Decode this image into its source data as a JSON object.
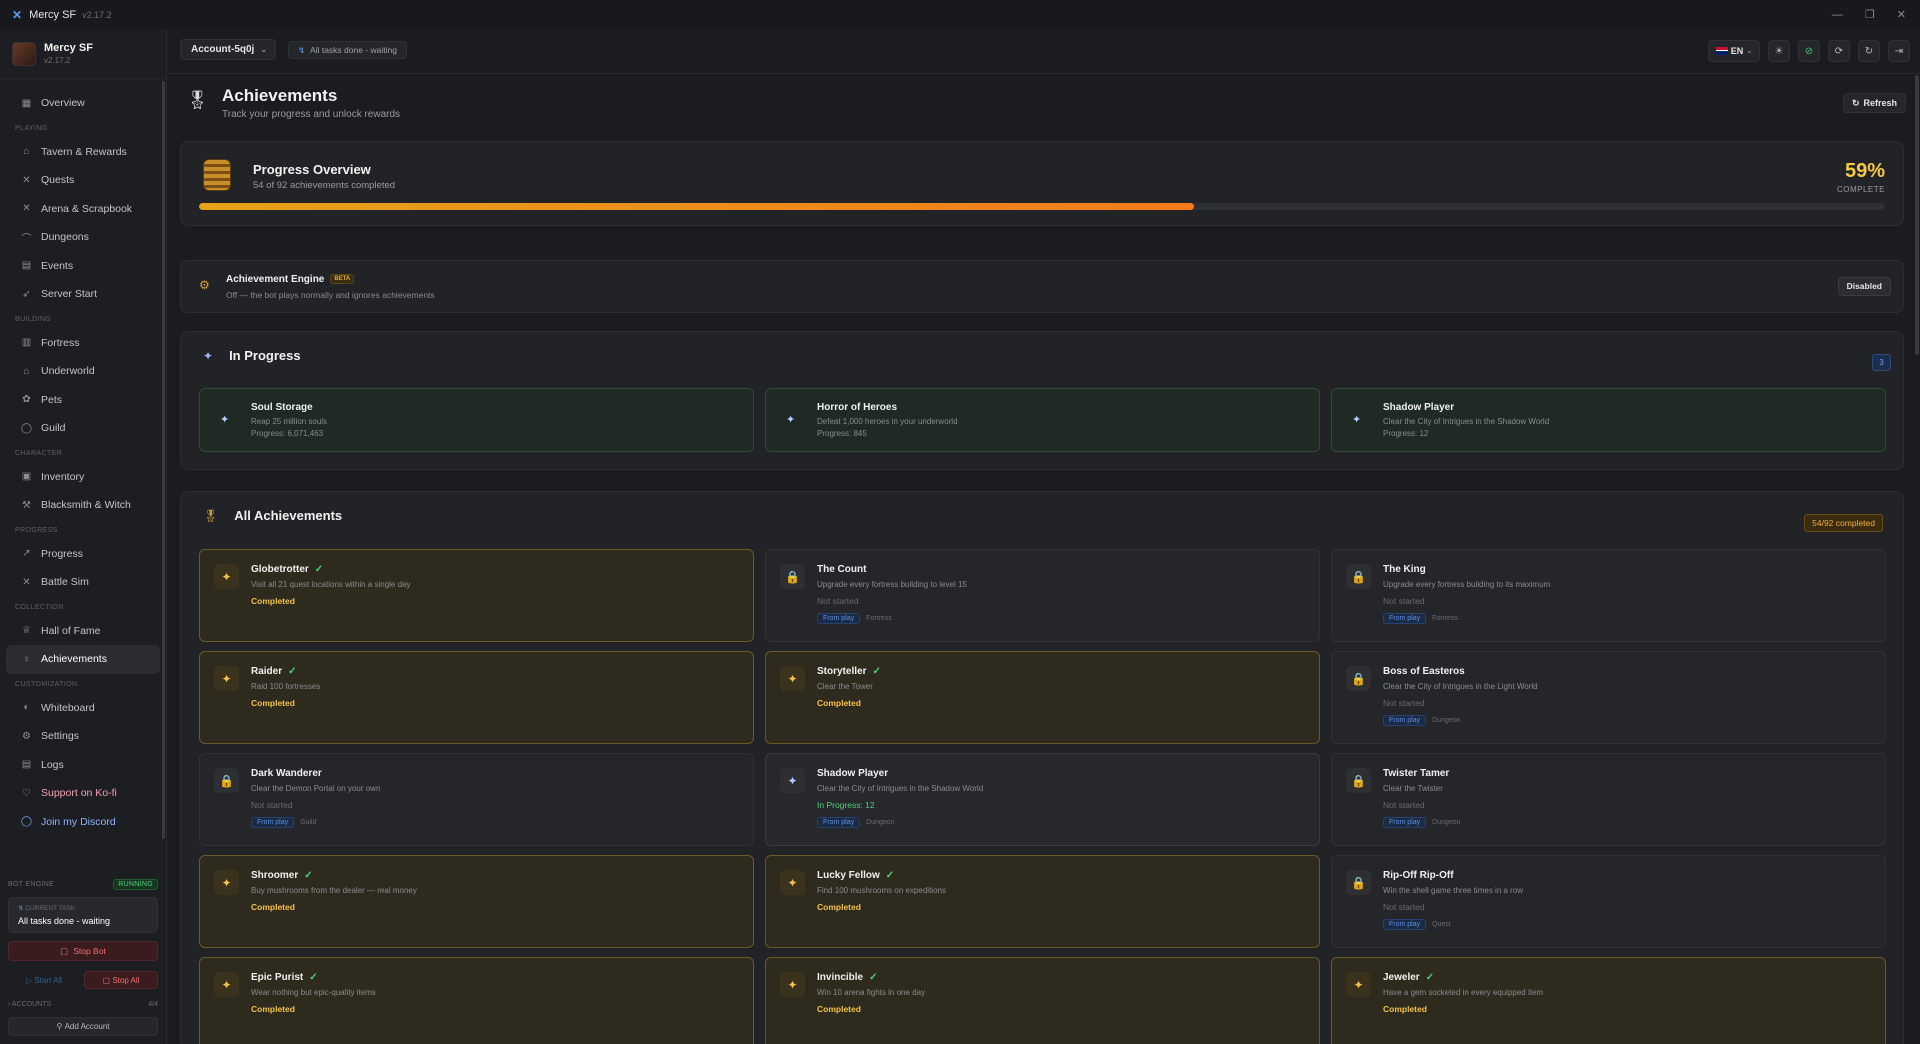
{
  "window": {
    "title": "Mercy SF",
    "version": "v2.17.2"
  },
  "brand": {
    "name": "Mercy SF",
    "version": "v2.17.2"
  },
  "sidebar": [
    {
      "type": "item",
      "label": "Overview",
      "icon": "grid-icon"
    },
    {
      "type": "section",
      "label": "PLAYING"
    },
    {
      "type": "item",
      "label": "Tavern & Rewards",
      "icon": "tavern-icon"
    },
    {
      "type": "item",
      "label": "Quests",
      "icon": "swords-icon"
    },
    {
      "type": "item",
      "label": "Arena & Scrapbook",
      "icon": "arena-icon"
    },
    {
      "type": "item",
      "label": "Dungeons",
      "icon": "dungeon-icon"
    },
    {
      "type": "item",
      "label": "Events",
      "icon": "calendar-icon"
    },
    {
      "type": "item",
      "label": "Server Start",
      "icon": "rocket-icon"
    },
    {
      "type": "section",
      "label": "BUILDING"
    },
    {
      "type": "item",
      "label": "Fortress",
      "icon": "castle-icon"
    },
    {
      "type": "item",
      "label": "Underworld",
      "icon": "flame-icon"
    },
    {
      "type": "item",
      "label": "Pets",
      "icon": "paw-icon"
    },
    {
      "type": "item",
      "label": "Guild",
      "icon": "shield-icon"
    },
    {
      "type": "section",
      "label": "CHARACTER"
    },
    {
      "type": "item",
      "label": "Inventory",
      "icon": "backpack-icon"
    },
    {
      "type": "item",
      "label": "Blacksmith & Witch",
      "icon": "hammer-icon"
    },
    {
      "type": "section",
      "label": "PROGRESS"
    },
    {
      "type": "item",
      "label": "Progress",
      "icon": "trend-icon"
    },
    {
      "type": "item",
      "label": "Battle Sim",
      "icon": "battle-icon"
    },
    {
      "type": "section",
      "label": "COLLECTION"
    },
    {
      "type": "item",
      "label": "Hall of Fame",
      "icon": "trophy-icon"
    },
    {
      "type": "item",
      "label": "Achievements",
      "icon": "medal-icon",
      "active": true
    },
    {
      "type": "section",
      "label": "CUSTOMIZATION"
    },
    {
      "type": "item",
      "label": "Whiteboard",
      "icon": "palette-icon"
    },
    {
      "type": "item",
      "label": "Settings",
      "icon": "gear-icon"
    },
    {
      "type": "item",
      "label": "Logs",
      "icon": "file-icon"
    },
    {
      "type": "item",
      "label": "Support on Ko-fi",
      "icon": "heart-icon",
      "variant": "kofi"
    },
    {
      "type": "item",
      "label": "Join my Discord",
      "icon": "chat-icon",
      "variant": "discord"
    }
  ],
  "bot_engine": {
    "label": "BOT ENGINE",
    "status": "RUNNING",
    "current_task_label": "CURRENT TASK",
    "current_task": "All tasks done - waiting",
    "stop_bot": "Stop Bot",
    "start_all": "Start All",
    "stop_all": "Stop All",
    "accounts_label": "ACCOUNTS",
    "accounts_count": "4/4",
    "add_account": "Add Account"
  },
  "topbar": {
    "account": "Account-5q0j",
    "status": "All tasks done - waiting",
    "language": "EN"
  },
  "page": {
    "title": "Achievements",
    "subtitle": "Track your progress and unlock rewards",
    "refresh": "Refresh"
  },
  "progress": {
    "title": "Progress Overview",
    "subtitle": "54 of 92 achievements completed",
    "percent_text": "59%",
    "percent_label": "COMPLETE",
    "fraction": 0.59,
    "colors": {
      "bar_start": "#e6a21a",
      "bar_end": "#f47a1c",
      "percent": "#f6c945"
    }
  },
  "engine": {
    "title": "Achievement Engine",
    "badge": "BETA",
    "subtitle": "Off — the bot plays normally and ignores achievements",
    "state": "Disabled"
  },
  "in_progress": {
    "title": "In Progress",
    "count": "3",
    "items": [
      {
        "name": "Soul Storage",
        "desc": "Reap 25 million souls",
        "progress": "Progress: 6,071,463"
      },
      {
        "name": "Horror of Heroes",
        "desc": "Defeat 1,000 heroes in your underworld",
        "progress": "Progress: 845"
      },
      {
        "name": "Shadow Player",
        "desc": "Clear the City of Intrigues in the Shadow World",
        "progress": "Progress: 12"
      }
    ]
  },
  "all": {
    "title": "All Achievements",
    "badge": "54/92 completed",
    "items": [
      {
        "name": "Globetrotter",
        "desc": "Visit all 21 quest locations within a single day",
        "state": "done",
        "status": "Completed"
      },
      {
        "name": "The Count",
        "desc": "Upgrade every fortress building to level 15",
        "state": "locked",
        "status": "Not started",
        "tag": "From play",
        "category": "Fortress"
      },
      {
        "name": "The King",
        "desc": "Upgrade every fortress building to its maximum",
        "state": "locked",
        "status": "Not started",
        "tag": "From play",
        "category": "Fortress"
      },
      {
        "name": "Raider",
        "desc": "Raid 100 fortresses",
        "state": "done",
        "status": "Completed"
      },
      {
        "name": "Storyteller",
        "desc": "Clear the Tower",
        "state": "done",
        "status": "Completed"
      },
      {
        "name": "Boss of Easteros",
        "desc": "Clear the City of Intrigues in the Light World",
        "state": "locked",
        "status": "Not started",
        "tag": "From play",
        "category": "Dungeon"
      },
      {
        "name": "Dark Wanderer",
        "desc": "Clear the Demon Portal on your own",
        "state": "locked",
        "status": "Not started",
        "tag": "From play",
        "category": "Guild"
      },
      {
        "name": "Shadow Player",
        "desc": "Clear the City of Intrigues in the Shadow World",
        "state": "inp",
        "status": "In Progress: 12",
        "tag": "From play",
        "category": "Dungeon"
      },
      {
        "name": "Twister Tamer",
        "desc": "Clear the Twister",
        "state": "locked",
        "status": "Not started",
        "tag": "From play",
        "category": "Dungeon"
      },
      {
        "name": "Shroomer",
        "desc": "Buy mushrooms from the dealer — real money",
        "state": "done",
        "status": "Completed"
      },
      {
        "name": "Lucky Fellow",
        "desc": "Find 100 mushrooms on expeditions",
        "state": "done",
        "status": "Completed"
      },
      {
        "name": "Rip-Off Rip-Off",
        "desc": "Win the shell game three times in a row",
        "state": "locked",
        "status": "Not started",
        "tag": "From play",
        "category": "Quest"
      },
      {
        "name": "Epic Purist",
        "desc": "Wear nothing but epic-quality items",
        "state": "done",
        "status": "Completed"
      },
      {
        "name": "Invincible",
        "desc": "Win 10 arena fights in one day",
        "state": "done",
        "status": "Completed"
      },
      {
        "name": "Jeweler",
        "desc": "Have a gem socketed in every equipped item",
        "state": "done",
        "status": "Completed"
      }
    ]
  }
}
